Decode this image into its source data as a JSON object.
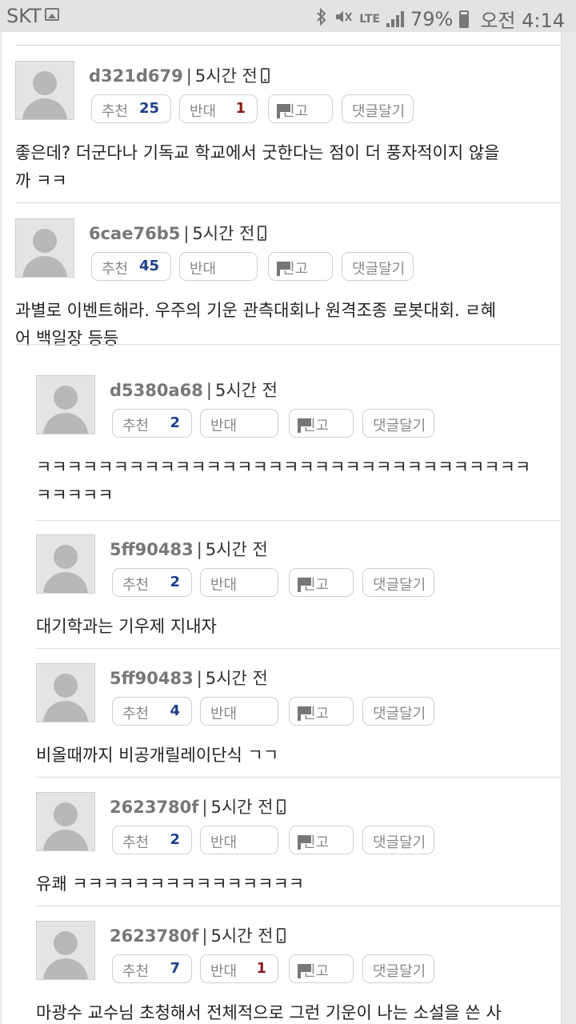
{
  "status_bar": {
    "carrier": "SKT",
    "lte": "LTE",
    "battery": "79%",
    "time": "오전 4:14",
    "icons": [
      "gallery-icon",
      "bluetooth-icon",
      "mute-icon",
      "lte-icon",
      "signal-icon",
      "battery-icon"
    ]
  },
  "labels": {
    "up": "추천",
    "down": "반대",
    "report": "신고",
    "reply": "댓글달기"
  },
  "comments": [
    {
      "user": "d321d679",
      "time": "5시간 전",
      "mobile": true,
      "up": "25",
      "down": "1",
      "text": "좋은데? 더군다나 기독교 학교에서 굿한다는 점이 더 풍자적이지 않을\n까 ㅋㅋ"
    },
    {
      "user": "6cae76b5",
      "time": "5시간 전",
      "mobile": true,
      "up": "45",
      "down": "",
      "text": "과별로 이벤트해라. 우주의 기운 관측대회나 원격조종 로봇대회. ㄹ혜\n어 백일장 등등"
    },
    {
      "user": "d5380a68",
      "time": "5시간 전",
      "mobile": false,
      "up": "2",
      "down": "",
      "text": "ㅋㅋㅋㅋㅋㅋㅋㅋㅋㅋㅋㅋㅋㅋㅋㅋㅋㅋㅋㅋㅋㅋㅋㅋㅋㅋㅋㅋㅋㅋㅋㅋ\nㅋㅋㅋㅋㅋ"
    },
    {
      "user": "5ff90483",
      "time": "5시간 전",
      "mobile": false,
      "up": "2",
      "down": "",
      "text": "대기학과는 기우제 지내자"
    },
    {
      "user": "5ff90483",
      "time": "5시간 전",
      "mobile": false,
      "up": "4",
      "down": "",
      "text": "비올때까지 비공개릴레이단식 ㄱㄱ"
    },
    {
      "user": "2623780f",
      "time": "5시간 전",
      "mobile": true,
      "up": "2",
      "down": "",
      "text": "유쾌 ㅋㅋㅋㅋㅋㅋㅋㅋㅋㅋㅋㅋㅋㅋㅋ"
    },
    {
      "user": "2623780f",
      "time": "5시간 전",
      "mobile": true,
      "up": "7",
      "down": "1",
      "text": "마광수 교수님 초청해서 전체적으로 그런 기운이 나는 소설을 쓴 사\n람 뽑아 진열해야 한다"
    }
  ]
}
